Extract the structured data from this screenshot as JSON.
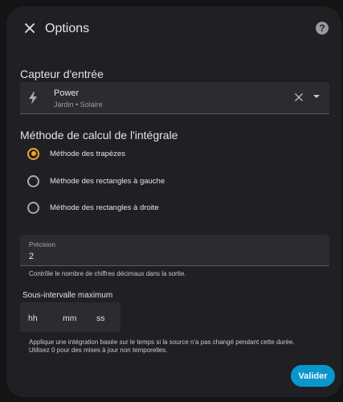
{
  "header": {
    "title": "Options",
    "help_glyph": "?"
  },
  "input_sensor": {
    "label": "Capteur d'entrée",
    "name": "Power",
    "subtitle": "Jardin • Solaire",
    "icon": "flash-icon"
  },
  "method": {
    "label": "Méthode de calcul de l'intégrale",
    "options": [
      {
        "label": "Méthode des trapèzes",
        "selected": true
      },
      {
        "label": "Méthode des rectangles à gauche",
        "selected": false
      },
      {
        "label": "Méthode des rectangles à droite",
        "selected": false
      }
    ]
  },
  "precision": {
    "label": "Précision",
    "value": "2",
    "helper": "Contrôle le nombre de chiffres décimaux dans la sortie."
  },
  "max_interval": {
    "label": "Sous-intervalle maximum",
    "hours_placeholder": "hh",
    "minutes_placeholder": "mm",
    "seconds_placeholder": "ss",
    "helper_line1": "Applique une intégration basée sur le temps si la source n'a pas changé pendant cette durée.",
    "helper_line2": "Utilisez 0 pour des mises à jour non temporelles."
  },
  "actions": {
    "submit_label": "Valider"
  },
  "colors": {
    "accent_radio": "#f0a52b",
    "primary_button": "#0a96cd",
    "surface": "#1f2024",
    "field": "#2a2c31"
  }
}
